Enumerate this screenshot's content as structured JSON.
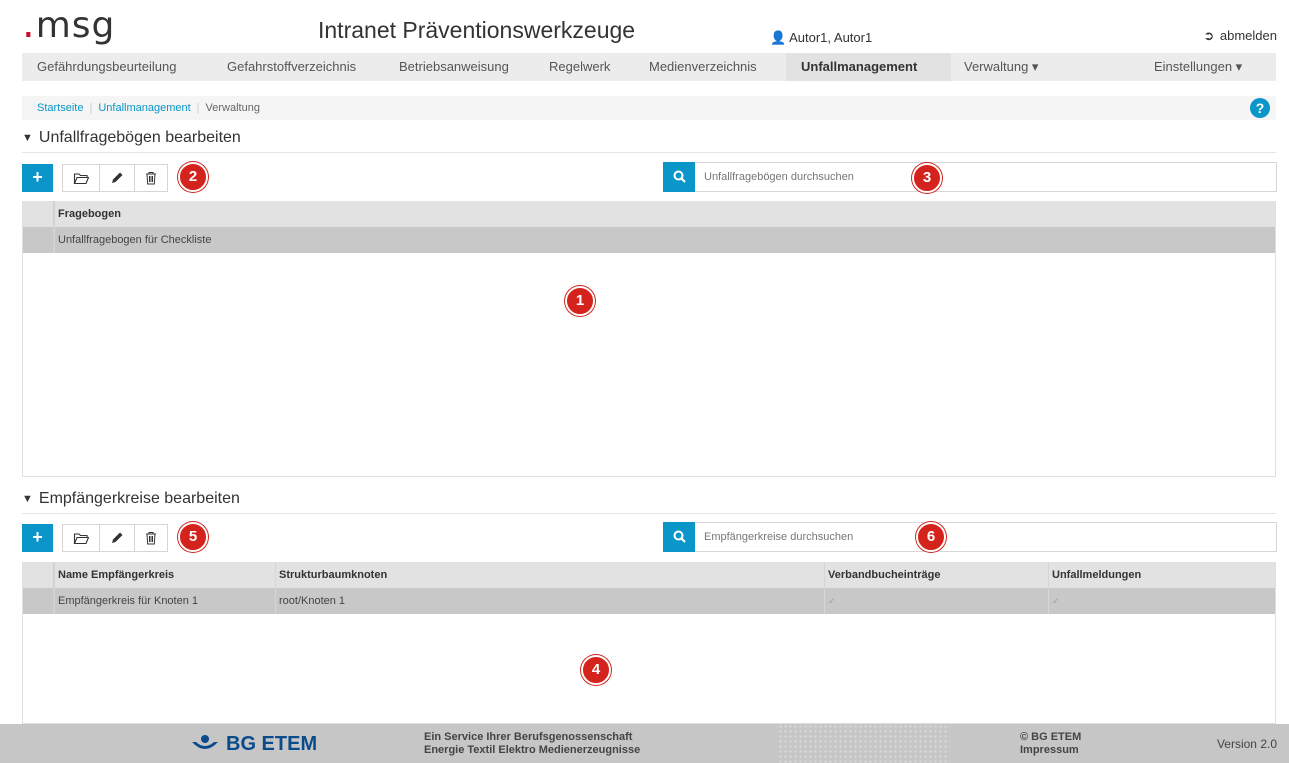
{
  "header": {
    "logo": "msg",
    "title": "Intranet Präventionswerkzeuge",
    "user": "Autor1, Autor1",
    "logout": "abmelden"
  },
  "nav": {
    "items": [
      {
        "label": "Gefährdungsbeurteilung"
      },
      {
        "label": "Gefahrstoffverzeichnis"
      },
      {
        "label": "Betriebsanweisung"
      },
      {
        "label": "Regelwerk"
      },
      {
        "label": "Medienverzeichnis"
      },
      {
        "label": "Unfallmanagement"
      },
      {
        "label": "Verwaltung ▾"
      },
      {
        "label": "Einstellungen ▾"
      }
    ],
    "active": "Unfallmanagement"
  },
  "breadcrumb": {
    "items": [
      "Startseite",
      "Unfallmanagement",
      "Verwaltung"
    ],
    "help": "?"
  },
  "section1": {
    "title": "Unfallfragebögen bearbeiten",
    "search_placeholder": "Unfallfragebögen durchsuchen",
    "columns": [
      "Fragebogen"
    ],
    "rows": [
      [
        "Unfallfragebogen für Checkliste"
      ]
    ]
  },
  "section2": {
    "title": "Empfängerkreise bearbeiten",
    "search_placeholder": "Empfängerkreise durchsuchen",
    "columns": [
      "Name Empfängerkreis",
      "Strukturbaumknoten",
      "Verbandbucheinträge",
      "Unfallmeldungen"
    ],
    "rows": [
      [
        "Empfängerkreis für Knoten 1",
        "root/Knoten 1",
        "✓",
        "✓"
      ]
    ]
  },
  "toolbar": {
    "add": "+",
    "open": "open-folder-icon",
    "edit": "pencil-icon",
    "delete": "trash-icon"
  },
  "badges": [
    "1",
    "2",
    "3",
    "4",
    "5",
    "6"
  ],
  "footer": {
    "logo": "BG ETEM",
    "service_line1": "Ein Service Ihrer Berufsgenossenschaft",
    "service_line2": "Energie Textil Elektro Medienerzeugnisse",
    "copyright": "© BG ETEM",
    "imprint": "Impressum",
    "version": "Version 2.0"
  },
  "colors": {
    "accent": "#0a96c8",
    "badge": "#d4231c",
    "logo_dot": "#c8102e",
    "footer_bg": "#c6c6c6",
    "selected_row": "#c8c8c8"
  }
}
